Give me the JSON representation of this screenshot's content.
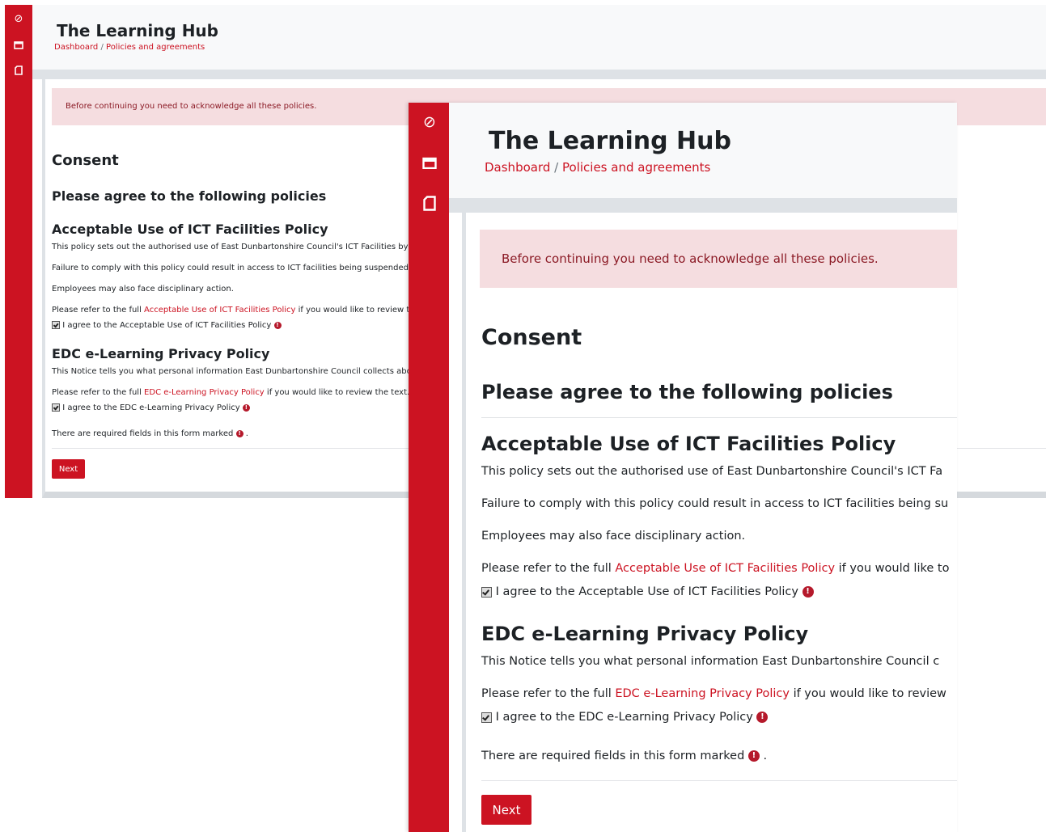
{
  "app": {
    "title": "The Learning Hub",
    "breadcrumb": [
      "Dashboard",
      "Policies and agreements"
    ],
    "breadcrumb_separator": "/"
  },
  "sidebar": {
    "icons": [
      "compass-icon",
      "calendar-icon",
      "file-icon"
    ]
  },
  "alert": {
    "text": "Before continuing you need to acknowledge all these policies."
  },
  "consent": {
    "heading": "Consent",
    "subheading": "Please agree to the following policies"
  },
  "policy1": {
    "title": "Acceptable Use of ICT Facilities Policy",
    "line1_small": "This policy sets out the authorised use of East Dunbartonshire Council's ICT Facilities by er",
    "line1_big": "This policy sets out the authorised use of East Dunbartonshire Council's ICT Fa",
    "line2_small": "Failure to comply with this policy could result in access to ICT facilities being suspended or",
    "line2_big": "Failure to comply with this policy could result in access to ICT facilities being su",
    "line3": "Employees may also face disciplinary action.",
    "refer_prefix": "Please refer to the full",
    "refer_link": "Acceptable Use of ICT Facilities Policy",
    "refer_suffix_small": "if you would like to review the",
    "refer_suffix_big": "if you would like to",
    "agree": "I agree to the Acceptable Use of ICT Facilities Policy"
  },
  "policy2": {
    "title": "EDC e-Learning Privacy Policy",
    "line1_small": "This Notice tells you what personal information East Dunbartonshire Council collects abou",
    "line1_big": "This Notice tells you what personal information East Dunbartonshire Council c",
    "refer_prefix": "Please refer to the full",
    "refer_link": "EDC e-Learning Privacy Policy",
    "refer_suffix_small": "if you would like to review the text.",
    "refer_suffix_big": "if you would like to review",
    "agree": "I agree to the EDC e-Learning Privacy Policy"
  },
  "required_note": {
    "text": "There are required fields in this form marked",
    "end": "."
  },
  "required_icon": "!",
  "next_button": "Next",
  "colors": {
    "brand": "#cc1322",
    "alert_bg": "#f5dde0"
  }
}
